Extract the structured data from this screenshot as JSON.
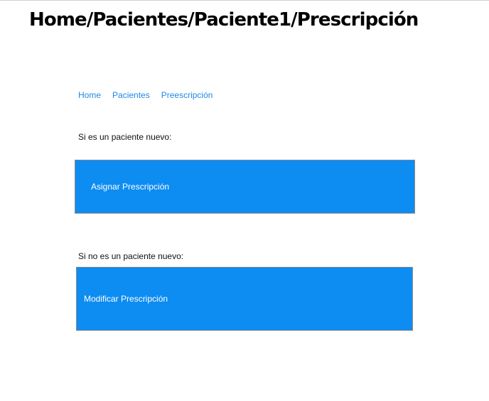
{
  "header": {
    "title": "Home/Pacientes/Paciente1/Prescripción"
  },
  "nav": {
    "items": [
      {
        "label": "Home"
      },
      {
        "label": "Pacientes"
      },
      {
        "label": "Preescripción"
      }
    ]
  },
  "sections": {
    "new_patient": {
      "label": "Si es un paciente nuevo:",
      "button_label": "Asignar Prescripción"
    },
    "existing_patient": {
      "label": "Si no es un paciente nuevo:",
      "button_label": "Modificar Prescripción"
    }
  },
  "colors": {
    "accent": "#0d8cf2",
    "link": "#1e88e5"
  }
}
